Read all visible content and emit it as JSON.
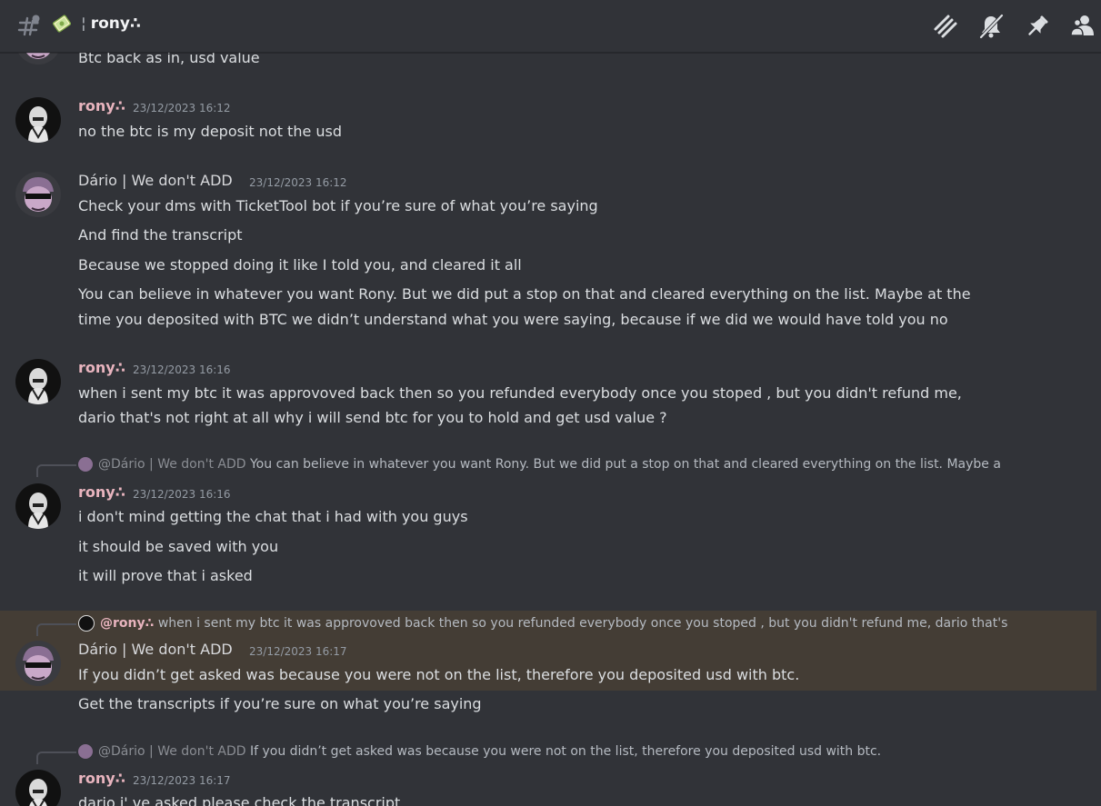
{
  "channel": {
    "name": "rony∴",
    "separator": "¦",
    "emoji_icon": "receipt-emoji-icon"
  },
  "header_icons": [
    "threads-icon",
    "mute-bell-icon",
    "pin-icon",
    "members-icon"
  ],
  "colors": {
    "background": "#313338",
    "rony_name": "#e8b4be",
    "highlight": "#443d35",
    "timestamp": "#949ba4"
  },
  "messages": [
    {
      "lines": [
        "Btc back as in, usd value"
      ]
    },
    {
      "author": "rony∴",
      "timestamp": "23/12/2023 16:12",
      "lines": [
        "no the btc is my deposit not the usd"
      ]
    },
    {
      "author": "Dário | We don't ADD",
      "timestamp": "23/12/2023 16:12",
      "lines": [
        "Check your dms with TicketTool bot if you’re sure of what you’re saying",
        "And find the transcript",
        "Because we stopped doing it like I told you, and cleared it all",
        "You can believe in whatever you want Rony. But we did put a stop on that and cleared everything on the list. Maybe at the",
        "time you deposited with BTC we didn’t understand what you were saying, because if we did we would have told you no"
      ]
    },
    {
      "author": "rony∴",
      "timestamp": "23/12/2023 16:16",
      "lines": [
        "when i sent my btc it was approvoved back then  so you refunded everybody once you stoped , but you didn't refund me,",
        "dario that's not right at all why i will send btc for you to hold and get usd value ?"
      ]
    },
    {
      "reply": {
        "author": "@Dário | We don't ADD",
        "text": "You can believe in whatever you want Rony. But we did put a stop on that and cleared everything on the list. Maybe a"
      },
      "author": "rony∴",
      "timestamp": "23/12/2023 16:16",
      "lines": [
        "i don't mind getting the chat that i had with you guys",
        "it should be saved with you",
        "it will prove that i asked"
      ]
    },
    {
      "reply": {
        "author": "@rony∴",
        "text": "when i sent my btc it was approvoved back then so you refunded everybody once you stoped , but you didn't refund me, dario that's"
      },
      "author": "Dário | We don't ADD",
      "timestamp": "23/12/2023 16:17",
      "lines": [
        "If you didn’t get asked was because you were not on the list, therefore you deposited usd with btc.",
        "Get the transcripts if you’re sure on what you’re saying"
      ]
    },
    {
      "reply": {
        "author": "@Dário | We don't ADD",
        "text": "If you didn’t get asked was because you were not on the list, therefore you deposited usd with btc."
      },
      "author": "rony∴",
      "timestamp": "23/12/2023 16:17",
      "lines": [
        "dario i' ve asked please check the transcript"
      ]
    }
  ]
}
